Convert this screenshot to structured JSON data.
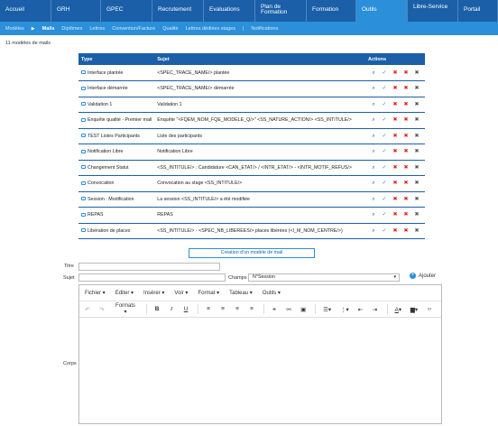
{
  "nav": {
    "items": [
      {
        "label": "Accueil",
        "name": "nav-accueil"
      },
      {
        "label": "GRH",
        "name": "nav-grh"
      },
      {
        "label": "GPEC",
        "name": "nav-gpec"
      },
      {
        "label": "Recrutement",
        "name": "nav-recrutement"
      },
      {
        "label": "Evaluations",
        "name": "nav-evaluations"
      },
      {
        "label": "Plan de Formation",
        "name": "nav-plan-formation"
      },
      {
        "label": "Formation",
        "name": "nav-formation"
      },
      {
        "label": "Outils",
        "name": "nav-outils",
        "active": true
      },
      {
        "label": "Libre-Service",
        "name": "nav-libre-service"
      },
      {
        "label": "Portail",
        "name": "nav-portail"
      }
    ]
  },
  "subnav": {
    "modeles": "Modèles",
    "mails": "Mails",
    "items": [
      "Diplômes",
      "Lettres",
      "Convention/Facture",
      "Qualité",
      "Lettres dédiées stages"
    ],
    "separator": "|",
    "notifications": "Notifications"
  },
  "count_label": "11 modèles de mails",
  "table": {
    "headers": {
      "type": "Type",
      "subject": "Sujet",
      "actions": "Actions"
    },
    "rows": [
      {
        "type": "Interface plantée",
        "subject": "<SPEC_TRACE_NAME/> plantée"
      },
      {
        "type": "Interface démarrée",
        "subject": "<SPEC_TRACE_NAME/> démarrée"
      },
      {
        "type": "Validation 1",
        "subject": "Validation 1"
      },
      {
        "type": "Enquête qualité - Premier mail",
        "subject": "Enquête \"<FQEM_NOM_FQE_MODELE_Q/>\" <SS_NATURE_ACTION/> <SS_INTITULE/>"
      },
      {
        "type": "TEST Listes Participants",
        "subject": "Liste des participants"
      },
      {
        "type": "Notification Libre",
        "subject": "Notification Libre"
      },
      {
        "type": "Changement Statut",
        "subject": "<SS_INTITULE/> : Candidature <CAN_ETAT/> / <INTR_ETAT/> - <INTR_MOTIF_REFUS/>"
      },
      {
        "type": "Convocation",
        "subject": "Convocation au stage <SS_INTITULE/>"
      },
      {
        "type": "Session : Modification",
        "subject": "La session <SS_INTITULE/> a été modifiée"
      },
      {
        "type": "REPAS",
        "subject": "REPAS"
      },
      {
        "type": "Libération de places",
        "subject": "<SS_INTITULE/> - <SPEC_NB_LIBEREES/> places libérées (<I_M_NOM_CENTRE/>)"
      }
    ],
    "action_icons": [
      "magnifier-icon",
      "pencil-icon",
      "red-x-icon",
      "red-x-icon",
      "delete-icon"
    ]
  },
  "create_button": "Création d'un modèle de mail",
  "form": {
    "titre_label": "Titre",
    "titre_value": "",
    "sujet_label": "Sujet",
    "sujet_value": "",
    "champs_label": "Champs",
    "champs_selected": "N°Session",
    "add_label": "Ajouter",
    "corps_label": "Corps"
  },
  "editor": {
    "menus": [
      "Fichier ▾",
      "Editer ▾",
      "Insérer ▾",
      "Voir ▾",
      "Format ▾",
      "Tableau ▾",
      "Outils ▾"
    ],
    "formats_label": "Formats ▾"
  },
  "colors": {
    "nav": "#1a5fa8",
    "subnav": "#2b8fd9",
    "danger": "#e0201c"
  }
}
